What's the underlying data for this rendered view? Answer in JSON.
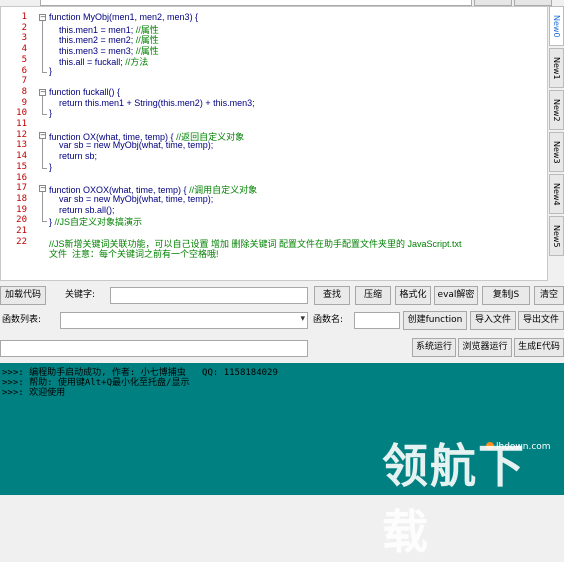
{
  "editor": {
    "lines": [
      {
        "n": "1",
        "code": "function MyObj(men1, men2, men3) {",
        "comment": ""
      },
      {
        "n": "2",
        "code": "    this.men1 = men1; ",
        "comment": "//属性"
      },
      {
        "n": "3",
        "code": "    this.men2 = men2; ",
        "comment": "//属性"
      },
      {
        "n": "4",
        "code": "    this.men3 = men3; ",
        "comment": "//属性"
      },
      {
        "n": "5",
        "code": "    this.all = fuckall; ",
        "comment": "//方法"
      },
      {
        "n": "6",
        "code": "}",
        "comment": ""
      },
      {
        "n": "7",
        "code": "",
        "comment": ""
      },
      {
        "n": "8",
        "code": "function fuckall() {",
        "comment": ""
      },
      {
        "n": "9",
        "code": "    return this.men1 + String(this.men2) + this.men3;",
        "comment": ""
      },
      {
        "n": "10",
        "code": "}",
        "comment": ""
      },
      {
        "n": "11",
        "code": "",
        "comment": ""
      },
      {
        "n": "12",
        "code": "function OX(what, time, temp) { ",
        "comment": "//返回自定义对象"
      },
      {
        "n": "13",
        "code": "    var sb = new MyObj(what, time, temp);",
        "comment": ""
      },
      {
        "n": "14",
        "code": "    return sb;",
        "comment": ""
      },
      {
        "n": "15",
        "code": "}",
        "comment": ""
      },
      {
        "n": "16",
        "code": "",
        "comment": ""
      },
      {
        "n": "17",
        "code": "function OXOX(what, time, temp) { ",
        "comment": "//调用自定义对象"
      },
      {
        "n": "18",
        "code": "    var sb = new MyObj(what, time, temp);",
        "comment": ""
      },
      {
        "n": "19",
        "code": "    return sb.all();",
        "comment": ""
      },
      {
        "n": "20",
        "code": "} ",
        "comment": "//JS自定义对象搞演示"
      },
      {
        "n": "21",
        "code": "",
        "comment": ""
      },
      {
        "n": "22",
        "code": "",
        "comment": "//JS新增关键词关联功能，可以自己设置 增加 删除关键词 配置文件在助手配置文件夹里的 JavaScript.txt"
      }
    ],
    "wrap_line": "文件  注意：每个关键词之前有一个空格哦!"
  },
  "side_tabs": [
    "New0",
    "New1",
    "New2",
    "New3",
    "New4",
    "New5"
  ],
  "toolbar1": {
    "load_code": "加载代码",
    "keyword_label": "关键字:",
    "find": "查找",
    "compress": "压缩",
    "format": "格式化",
    "eval_decrypt": "eval解密",
    "copy_js": "复制JS",
    "clear": "清空"
  },
  "toolbar2": {
    "func_list_label": "函数列表:",
    "func_name_label": "函数名:",
    "create_function": "创建function",
    "import_file": "导入文件",
    "export_file": "导出文件"
  },
  "toolbar3": {
    "system_run": "系统运行",
    "browser_run": "浏览器运行",
    "generate_exe": "生成E代码"
  },
  "console": {
    "lines": [
      ">>>: 编程助手启动成功, 作者: 小七博捕虫   QQ: 1158184029",
      ">>>: 帮助: 使用键Alt+Q最小化至托盘/显示",
      ">>>: 欢迎使用"
    ]
  },
  "watermark": {
    "text": "领航下载",
    "url": "lhdown.com"
  }
}
